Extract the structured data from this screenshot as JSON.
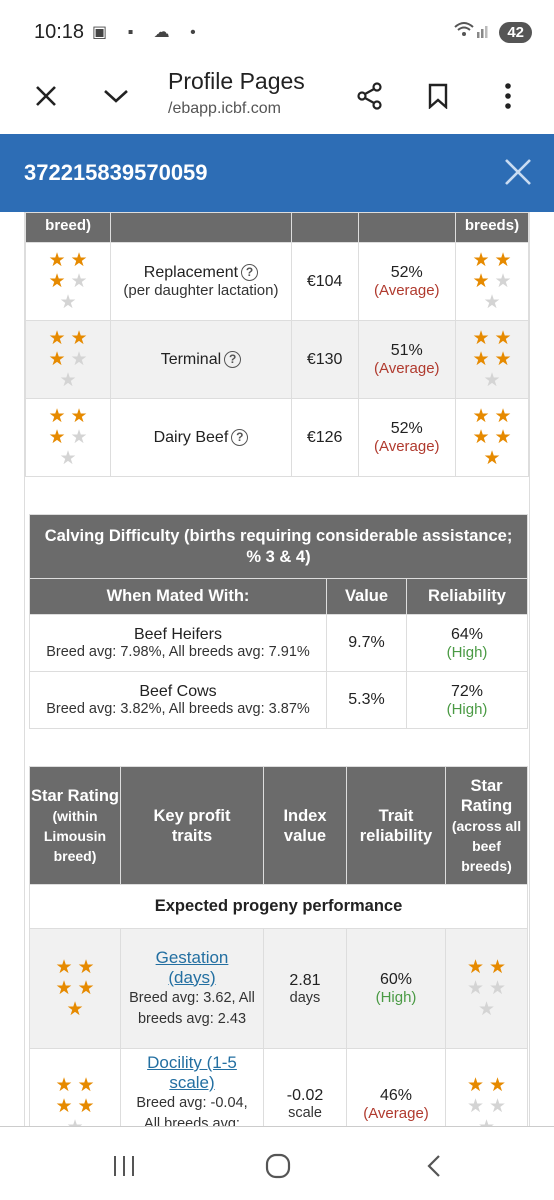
{
  "status_bar": {
    "time": "10:18",
    "icons": "▣ ▪ ☁ •",
    "battery": "42"
  },
  "toolbar": {
    "title": "Profile Pages",
    "url": "/ebapp.icbf.com"
  },
  "modal": {
    "animal_id": "372215839570059"
  },
  "top_table": {
    "header_partial": {
      "left": "breed)",
      "right": "breeds)"
    },
    "rows": [
      {
        "name": "Replacement",
        "sub": "(per daughter lactation)",
        "value": "€104",
        "reliability": "52%",
        "rel_label": "(Average)",
        "left_stars": 3,
        "right_stars": 3
      },
      {
        "name": "Terminal",
        "sub": "",
        "value": "€130",
        "reliability": "51%",
        "rel_label": "(Average)",
        "left_stars": 3,
        "right_stars": 4
      },
      {
        "name": "Dairy Beef",
        "sub": "",
        "value": "€126",
        "reliability": "52%",
        "rel_label": "(Average)",
        "left_stars": 3,
        "right_stars": 5
      }
    ],
    "help_icon": "?"
  },
  "calving": {
    "title": "Calving Difficulty (births requiring considerable assistance; % 3 & 4)",
    "col_mated": "When Mated With:",
    "col_value": "Value",
    "col_reliability": "Reliability",
    "rows": [
      {
        "name": "Beef Heifers",
        "sub": "Breed avg: 7.98%, All breeds avg: 7.91%",
        "value": "9.7%",
        "reliability": "64%",
        "rel_label": "(High)"
      },
      {
        "name": "Beef Cows",
        "sub": "Breed avg: 3.82%, All breeds avg: 3.87%",
        "value": "5.3%",
        "reliability": "72%",
        "rel_label": "(High)"
      }
    ]
  },
  "traits": {
    "col_star_within_1": "Star Rating",
    "col_star_within_2": "(within Limousin breed)",
    "col_key": "Key profit traits",
    "col_index": "Index value",
    "col_reliability": "Trait reliability",
    "col_star_across_1": "Star Rating",
    "col_star_across_2": "(across all beef breeds)",
    "section": "Expected progeny performance",
    "rows": [
      {
        "name": "Gestation (days)",
        "sub": "Breed avg: 3.62, All breeds avg: 2.43",
        "value": "2.81",
        "unit": "days",
        "reliability": "60%",
        "rel_label": "(High)",
        "left_stars": 5,
        "right_stars": 2
      },
      {
        "name": "Docility (1-5 scale)",
        "sub": "Breed avg: -0.04, All breeds avg:",
        "value": "-0.02",
        "unit": "scale",
        "reliability": "46%",
        "rel_label": "(Average)",
        "left_stars": 4,
        "right_stars": 2
      }
    ]
  },
  "colors": {
    "modal_blue": "#2d6db5",
    "header_grey": "#6b6b6b",
    "star_on": "#e68a00",
    "star_off": "#d4d4d4",
    "average_red": "#b03a2e",
    "high_green": "#4a9a44"
  }
}
